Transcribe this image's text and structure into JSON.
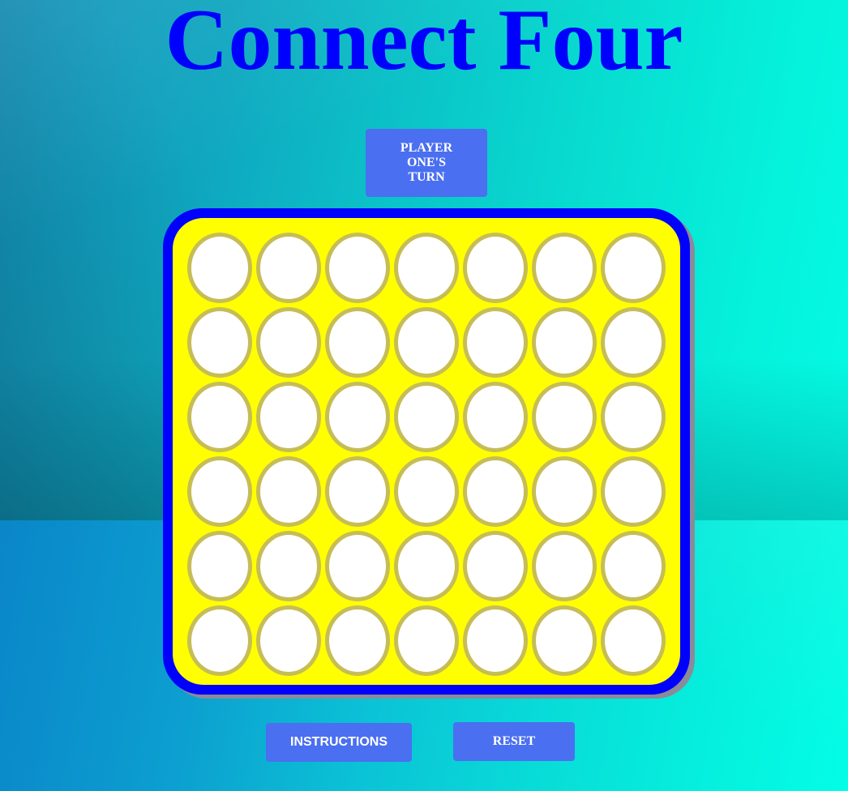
{
  "game": {
    "title": "Connect Four",
    "turn_indicator": "PLAYER ONE'S TURN",
    "instructions_label": "INSTRUCTIONS",
    "reset_label": "RESET"
  },
  "board": {
    "columns": 7,
    "rows": 6,
    "cells": [
      [
        "empty",
        "empty",
        "empty",
        "empty",
        "empty",
        "empty",
        "empty"
      ],
      [
        "empty",
        "empty",
        "empty",
        "empty",
        "empty",
        "empty",
        "empty"
      ],
      [
        "empty",
        "empty",
        "empty",
        "empty",
        "empty",
        "empty",
        "empty"
      ],
      [
        "empty",
        "empty",
        "empty",
        "empty",
        "empty",
        "empty",
        "empty"
      ],
      [
        "empty",
        "empty",
        "empty",
        "empty",
        "empty",
        "empty",
        "empty"
      ],
      [
        "empty",
        "empty",
        "empty",
        "empty",
        "empty",
        "empty",
        "empty"
      ]
    ]
  },
  "colors": {
    "title": "#0000ff",
    "button": "#4a6ff0",
    "board_frame": "#0000ff",
    "board_face": "#ffff00",
    "cell_empty": "#ffffff",
    "cell_rim": "#c6bd56"
  }
}
